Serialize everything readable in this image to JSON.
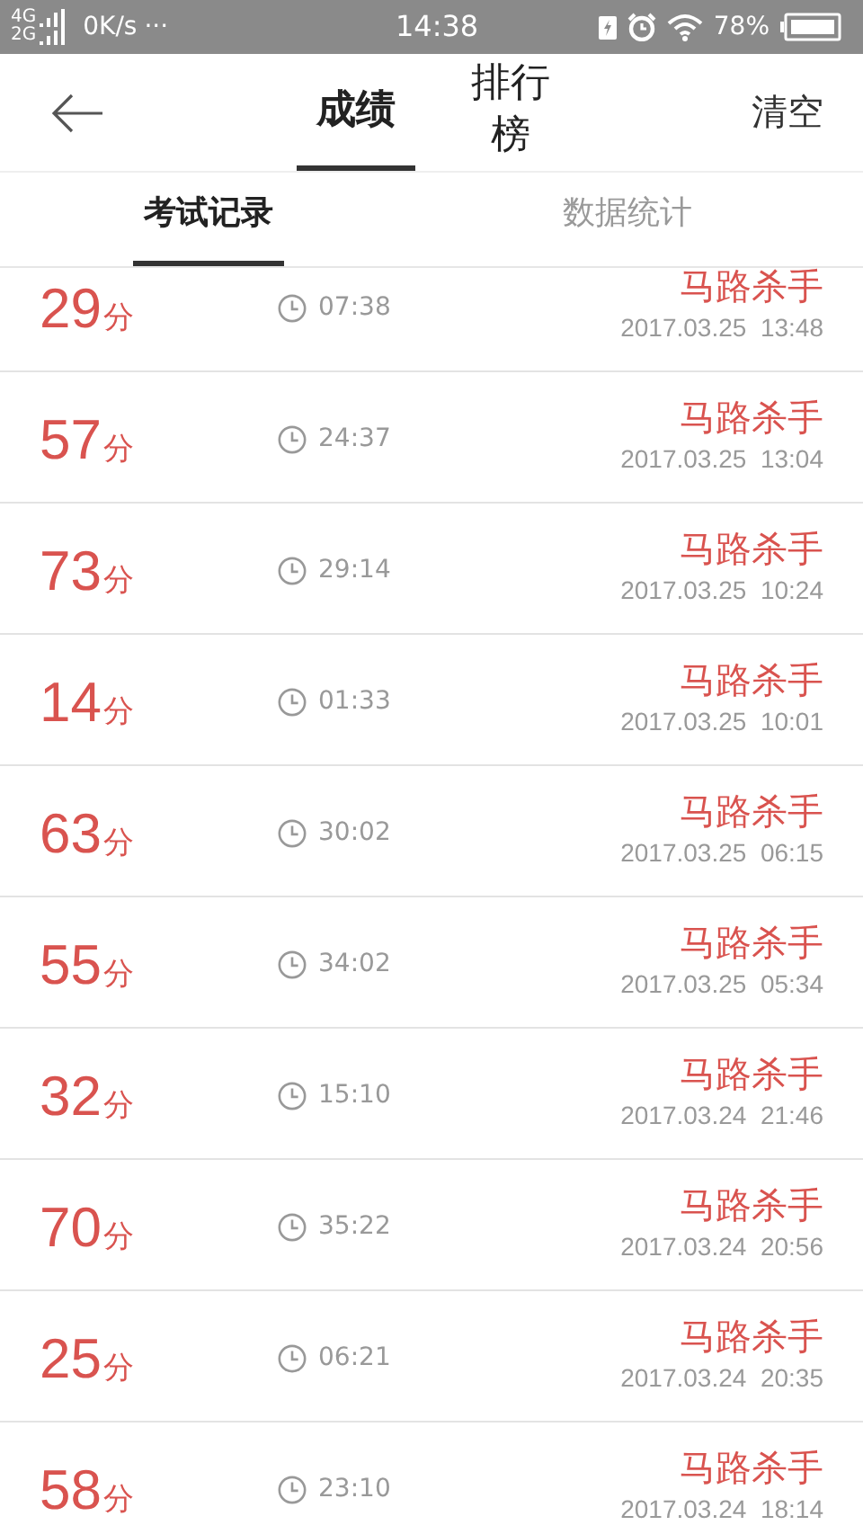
{
  "status_bar": {
    "network_top": "4G",
    "network_bottom": "2G",
    "speed": "0K/s",
    "more": "···",
    "time": "14:38",
    "battery": "78%"
  },
  "header": {
    "tabs": [
      {
        "label": "成绩",
        "selected": true
      },
      {
        "label": "排行榜",
        "selected": false
      }
    ],
    "action": "清空"
  },
  "sub_tabs": [
    {
      "label": "考试记录",
      "selected": true
    },
    {
      "label": "数据统计",
      "selected": false
    }
  ],
  "records": [
    {
      "score": "29",
      "unit": "分",
      "duration": "07:38",
      "name": "马路杀手",
      "date": "2017.03.25",
      "time": "13:48"
    },
    {
      "score": "57",
      "unit": "分",
      "duration": "24:37",
      "name": "马路杀手",
      "date": "2017.03.25",
      "time": "13:04"
    },
    {
      "score": "73",
      "unit": "分",
      "duration": "29:14",
      "name": "马路杀手",
      "date": "2017.03.25",
      "time": "10:24"
    },
    {
      "score": "14",
      "unit": "分",
      "duration": "01:33",
      "name": "马路杀手",
      "date": "2017.03.25",
      "time": "10:01"
    },
    {
      "score": "63",
      "unit": "分",
      "duration": "30:02",
      "name": "马路杀手",
      "date": "2017.03.25",
      "time": "06:15"
    },
    {
      "score": "55",
      "unit": "分",
      "duration": "34:02",
      "name": "马路杀手",
      "date": "2017.03.25",
      "time": "05:34"
    },
    {
      "score": "32",
      "unit": "分",
      "duration": "15:10",
      "name": "马路杀手",
      "date": "2017.03.24",
      "time": "21:46"
    },
    {
      "score": "70",
      "unit": "分",
      "duration": "35:22",
      "name": "马路杀手",
      "date": "2017.03.24",
      "time": "20:56"
    },
    {
      "score": "25",
      "unit": "分",
      "duration": "06:21",
      "name": "马路杀手",
      "date": "2017.03.24",
      "time": "20:35"
    },
    {
      "score": "58",
      "unit": "分",
      "duration": "23:10",
      "name": "马路杀手",
      "date": "2017.03.24",
      "time": "18:14"
    }
  ]
}
